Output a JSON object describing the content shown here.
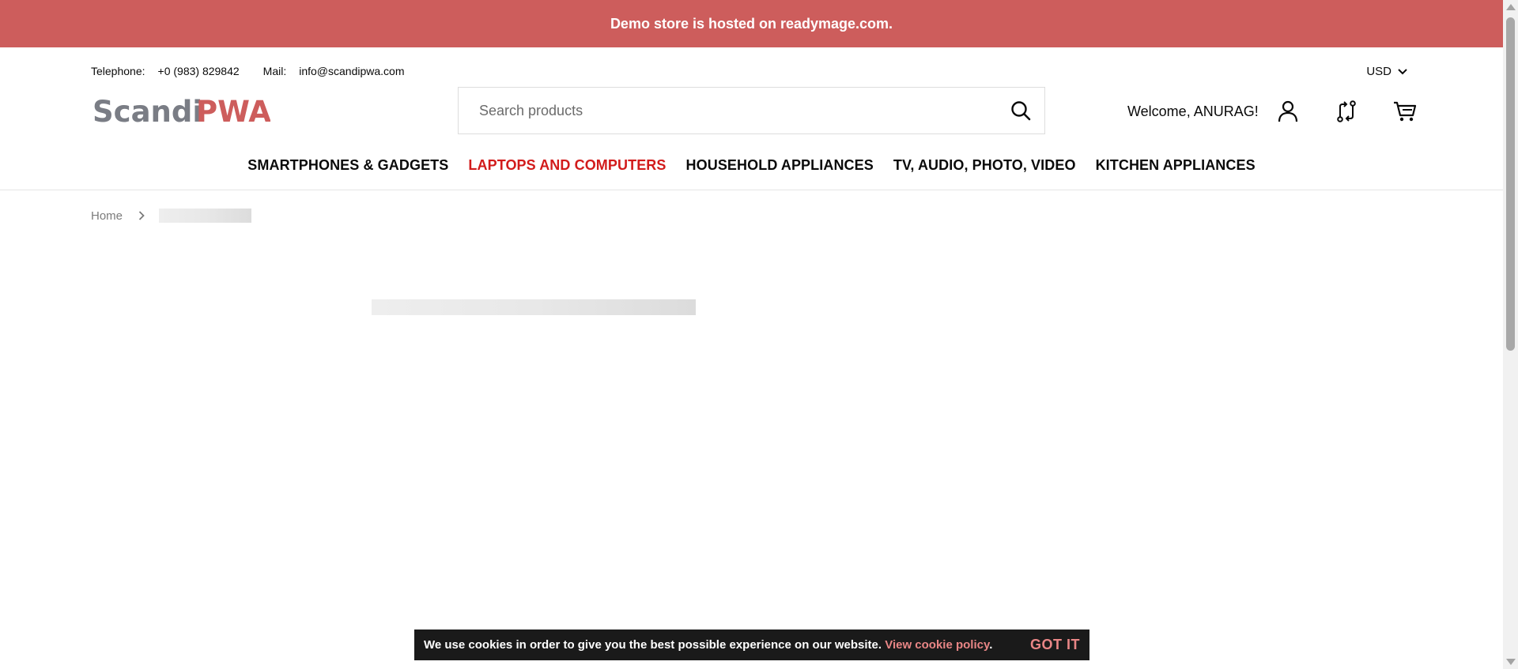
{
  "banner": {
    "text": "Demo store is hosted on readymage.com."
  },
  "topbar": {
    "telephone_label": "Telephone:",
    "telephone_value": "+0 (983) 829842",
    "mail_label": "Mail:",
    "mail_value": "info@scandipwa.com"
  },
  "currency": {
    "value": "USD"
  },
  "logo": {
    "text_gray": "Scandi",
    "text_red": "PWA",
    "colors": {
      "gray": "#7a7d85",
      "red": "#cd5d5c"
    }
  },
  "search": {
    "placeholder": "Search products"
  },
  "account": {
    "welcome": "Welcome, ANURAG!",
    "icons": [
      "user-icon",
      "compare-icon",
      "cart-icon"
    ]
  },
  "nav": {
    "items": [
      {
        "label": "SMARTPHONES & GADGETS",
        "active": false
      },
      {
        "label": "LAPTOPS AND COMPUTERS",
        "active": true
      },
      {
        "label": "HOUSEHOLD APPLIANCES",
        "active": false
      },
      {
        "label": "TV, AUDIO, PHOTO, VIDEO",
        "active": false
      },
      {
        "label": "KITCHEN APPLIANCES",
        "active": false
      }
    ]
  },
  "breadcrumb": {
    "home": "Home"
  },
  "cookie": {
    "message": "We use cookies in order to give you the best possible experience on our website.",
    "link": "View cookie policy",
    "period": ".",
    "button": "GOT IT"
  },
  "colors": {
    "accent": "#cd5d5c",
    "active_nav": "#d21b1b",
    "cookie_bg": "#1a1a1a",
    "cookie_link": "#e98686"
  }
}
